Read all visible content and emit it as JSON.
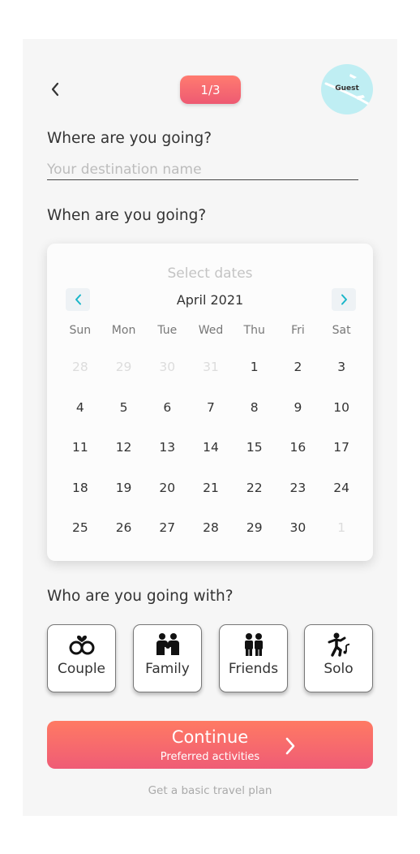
{
  "header": {
    "step": "1/3",
    "avatar_label": "Guest"
  },
  "destination": {
    "question": "Where are you going?",
    "placeholder": "Your destination name",
    "value": ""
  },
  "dates": {
    "question": "When are you going?",
    "calendar": {
      "hint": "Select dates",
      "month": "April 2021",
      "weekdays": [
        "Sun",
        "Mon",
        "Tue",
        "Wed",
        "Thu",
        "Fri",
        "Sat"
      ],
      "days": [
        {
          "d": "28",
          "muted": true
        },
        {
          "d": "29",
          "muted": true
        },
        {
          "d": "30",
          "muted": true
        },
        {
          "d": "31",
          "muted": true
        },
        {
          "d": "1"
        },
        {
          "d": "2"
        },
        {
          "d": "3"
        },
        {
          "d": "4"
        },
        {
          "d": "5"
        },
        {
          "d": "6"
        },
        {
          "d": "7"
        },
        {
          "d": "8"
        },
        {
          "d": "9"
        },
        {
          "d": "10"
        },
        {
          "d": "11"
        },
        {
          "d": "12"
        },
        {
          "d": "13"
        },
        {
          "d": "14"
        },
        {
          "d": "15"
        },
        {
          "d": "16"
        },
        {
          "d": "17"
        },
        {
          "d": "18"
        },
        {
          "d": "19"
        },
        {
          "d": "20"
        },
        {
          "d": "21"
        },
        {
          "d": "22"
        },
        {
          "d": "23"
        },
        {
          "d": "24"
        },
        {
          "d": "25"
        },
        {
          "d": "26"
        },
        {
          "d": "27"
        },
        {
          "d": "28"
        },
        {
          "d": "29"
        },
        {
          "d": "30"
        },
        {
          "d": "1",
          "muted": true
        }
      ]
    }
  },
  "companions": {
    "question": "Who are you going with?",
    "options": [
      {
        "label": "Couple",
        "icon": "couple-icon"
      },
      {
        "label": "Family",
        "icon": "family-icon"
      },
      {
        "label": "Friends",
        "icon": "friends-icon"
      },
      {
        "label": "Solo",
        "icon": "solo-icon"
      }
    ]
  },
  "actions": {
    "continue_label": "Continue",
    "continue_sub": "Preferred activities",
    "basic_plan_link": "Get a basic travel plan"
  },
  "colors": {
    "accent_start": "#ff7b70",
    "accent_end": "#ee5a72",
    "nav_arrow": "#19b6c9",
    "avatar_bg": "#bfeef3"
  }
}
